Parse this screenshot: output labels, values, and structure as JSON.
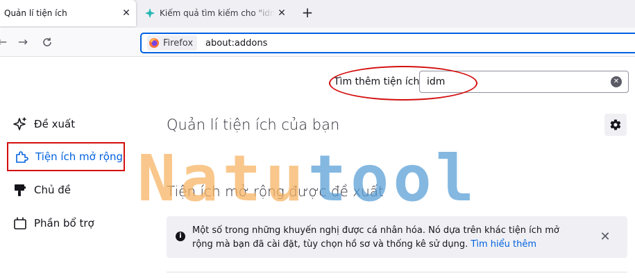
{
  "tabs": [
    {
      "label": "Quản lí tiện ích",
      "active": true
    },
    {
      "label": "Kiếm quả tìm kiếm cho \"idm\" – …",
      "active": false
    }
  ],
  "nav": {
    "identity_label": "Firefox",
    "url": "about:addons"
  },
  "search": {
    "label": "Tìm thêm tiện ích",
    "value": "idm"
  },
  "sidebar": {
    "items": [
      {
        "label": "Đề xuất",
        "icon": "sparkle-icon"
      },
      {
        "label": "Tiện ích mở rộng",
        "icon": "puzzle-icon",
        "selected": true
      },
      {
        "label": "Chủ đề",
        "icon": "paintbrush-icon"
      },
      {
        "label": "Phần bổ trợ",
        "icon": "plugin-icon"
      }
    ]
  },
  "main": {
    "title": "Quản lí tiện ích của bạn",
    "section_title": "Tiện ích mở rộng được đề xuất",
    "notice_text": "Một số trong những khuyến nghị được cá nhân hóa. Nó dựa trên khác tiện ích mở rộng mà bạn đã cài đặt, tùy chọn hồ sơ và thống kê sử dụng.",
    "notice_link": "Tìm hiểu thêm"
  },
  "watermark": {
    "part1": "Natu",
    "part2": "tool"
  },
  "colors": {
    "accent": "#0061e0",
    "annotation_red": "#d40e0e",
    "watermark_orange": "#f7b260",
    "watermark_blue": "#549cd6"
  }
}
